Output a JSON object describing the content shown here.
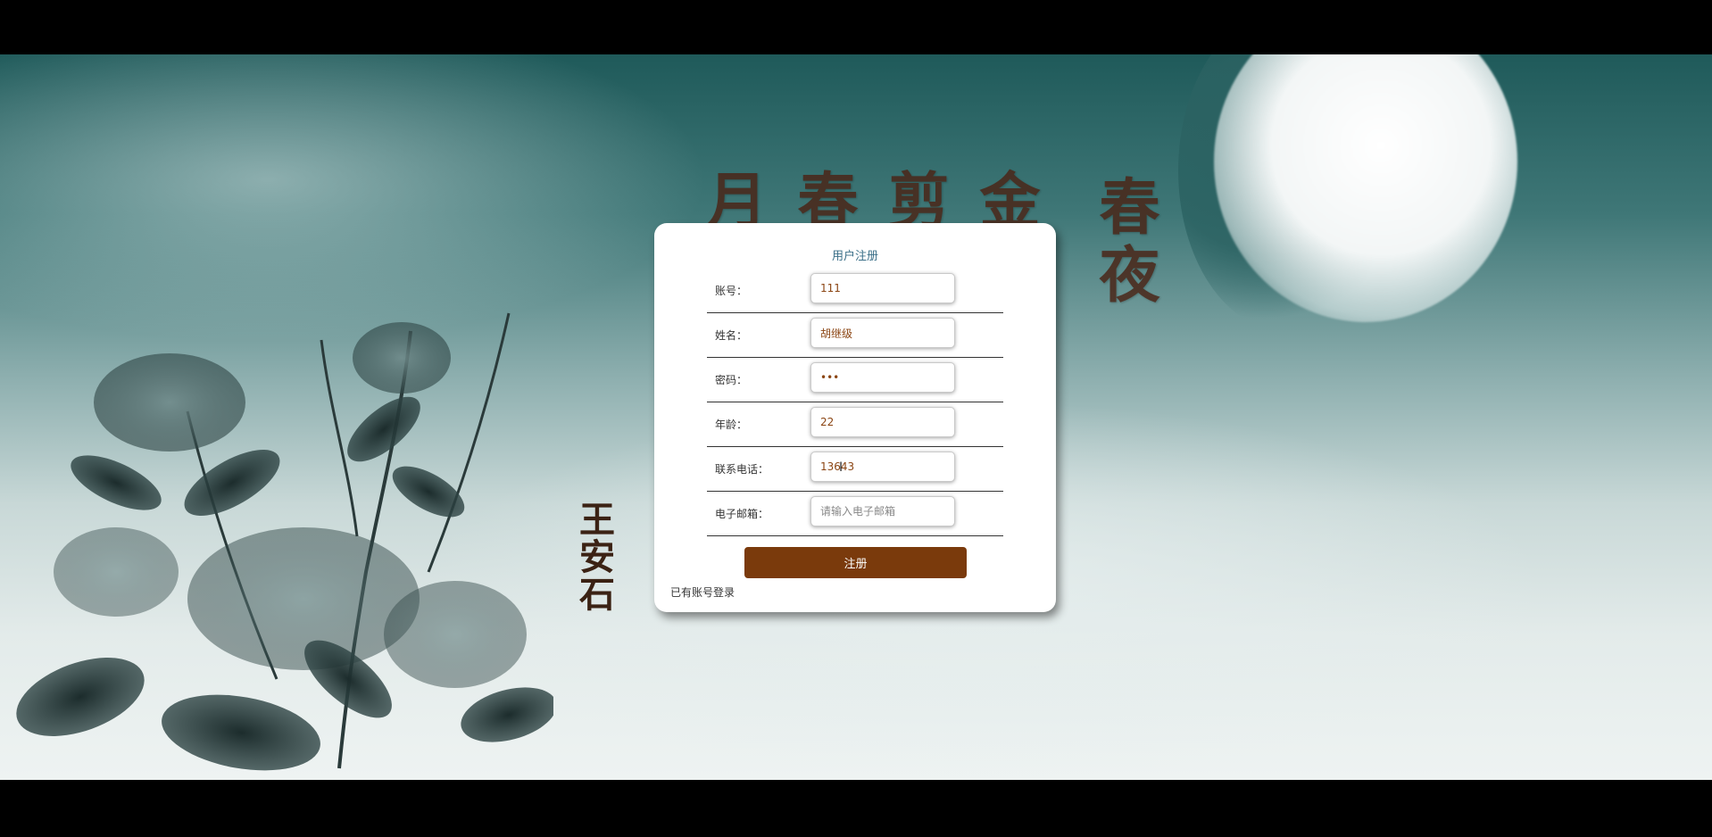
{
  "form": {
    "title": "用户注册",
    "fields": [
      {
        "label": "账号：",
        "value": "111",
        "placeholder": ""
      },
      {
        "label": "姓名：",
        "value": "胡继级",
        "placeholder": ""
      },
      {
        "label": "密码：",
        "value": "•••",
        "placeholder": ""
      },
      {
        "label": "年龄：",
        "value": "22",
        "placeholder": ""
      },
      {
        "label": "联系电话：",
        "value": "13643",
        "placeholder": ""
      },
      {
        "label": "电子邮箱：",
        "value": "",
        "placeholder": "请输入电子邮箱"
      }
    ],
    "submit_label": "注册",
    "login_link": "已有账号登录"
  },
  "background": {
    "poem_lines": [
      "春夜",
      "月",
      "春",
      "剪",
      "金"
    ],
    "author": "王安石"
  },
  "colors": {
    "accent": "#7a3a0c",
    "title": "#3b6f88",
    "scene_top": "#1f5a5a"
  }
}
